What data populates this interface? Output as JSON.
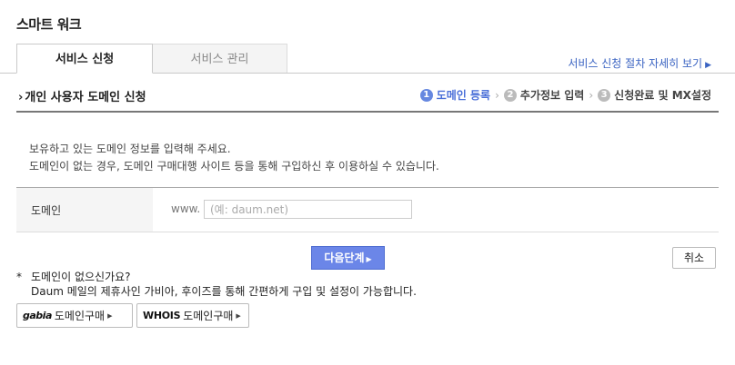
{
  "app": {
    "title": "스마트 워크"
  },
  "tabs": [
    {
      "label": "서비스 신청",
      "active": true
    },
    {
      "label": "서비스 관리",
      "active": false
    }
  ],
  "guide_link": {
    "label": "서비스 신청 절차 자세히 보기"
  },
  "section": {
    "title": "개인 사용자 도메인 신청"
  },
  "steps": [
    {
      "num": "1",
      "label": "도메인 등록",
      "active": true
    },
    {
      "num": "2",
      "label": "추가정보 입력",
      "active": false
    },
    {
      "num": "3",
      "label": "신청완료 및 MX설정",
      "active": false
    }
  ],
  "description": {
    "line1": "보유하고 있는 도메인 정보를 입력해 주세요.",
    "line2": "도메인이 없는 경우, 도메인 구매대행 사이트 등을 통해 구입하신 후 이용하실 수 있습니다."
  },
  "form": {
    "label": "도메인",
    "prefix": "www.",
    "input_value": "",
    "placeholder": "(예: daum.net)"
  },
  "buttons": {
    "next": "다음단계",
    "cancel": "취소"
  },
  "note": {
    "star": "*",
    "title": "도메인이 없으신가요?",
    "text": "Daum 메일의 제휴사인 가비아, 후이즈를 통해 간편하게 구입 및 설정이 가능합니다."
  },
  "purchase": [
    {
      "logo": "gabia",
      "label": "도메인구매"
    },
    {
      "logo": "WHOIS",
      "label": "도메인구매"
    }
  ],
  "colors": {
    "accent": "#6b86e8",
    "link": "#3a63c2",
    "step_active": "#4a6fd8"
  }
}
